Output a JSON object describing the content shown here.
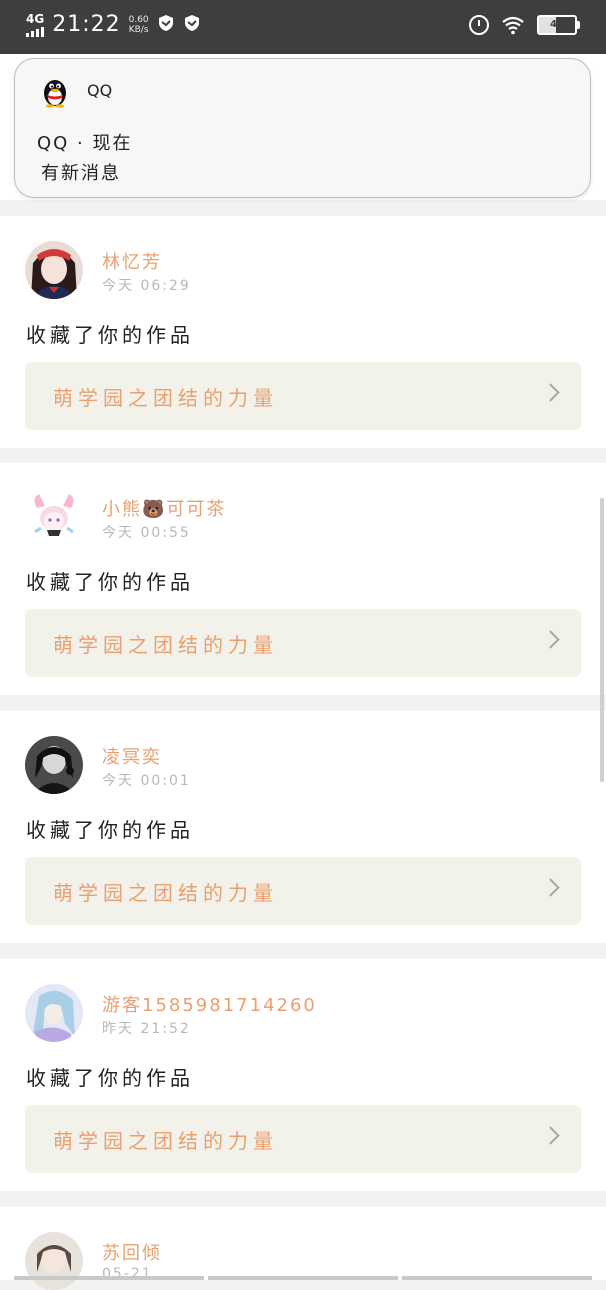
{
  "status_bar": {
    "network": "4G",
    "time": "21:22",
    "speed_value": "0.60",
    "speed_unit": "KB/s",
    "battery": "46",
    "battery_fraction": 0.46
  },
  "notification": {
    "app_name": "QQ",
    "title": "QQ · 现在",
    "text": "有新消息"
  },
  "feed": [
    {
      "username": "林忆芳",
      "time": "今天 06:29",
      "action": "收藏了你的作品",
      "work_title": "萌学园之团结的力量",
      "avatar": "avatar-girl-red"
    },
    {
      "username": "小熊🐻可可茶",
      "time": "今天 00:55",
      "action": "收藏了你的作品",
      "work_title": "萌学园之团结的力量",
      "avatar": "avatar-pink-anime"
    },
    {
      "username": "凌冥奕",
      "time": "今天 00:01",
      "action": "收藏了你的作品",
      "work_title": "萌学园之团结的力量",
      "avatar": "avatar-dark"
    },
    {
      "username": "游客1585981714260",
      "time": "昨天 21:52",
      "action": "收藏了你的作品",
      "work_title": "萌学园之团结的力量",
      "avatar": "avatar-blue-anime"
    },
    {
      "username": "苏回倾",
      "time": "05-21",
      "avatar": "avatar-light"
    }
  ],
  "colors": {
    "username": "#e8a070",
    "status_bar_bg": "#3e3e3e",
    "work_bg": "#f3f2ea"
  }
}
